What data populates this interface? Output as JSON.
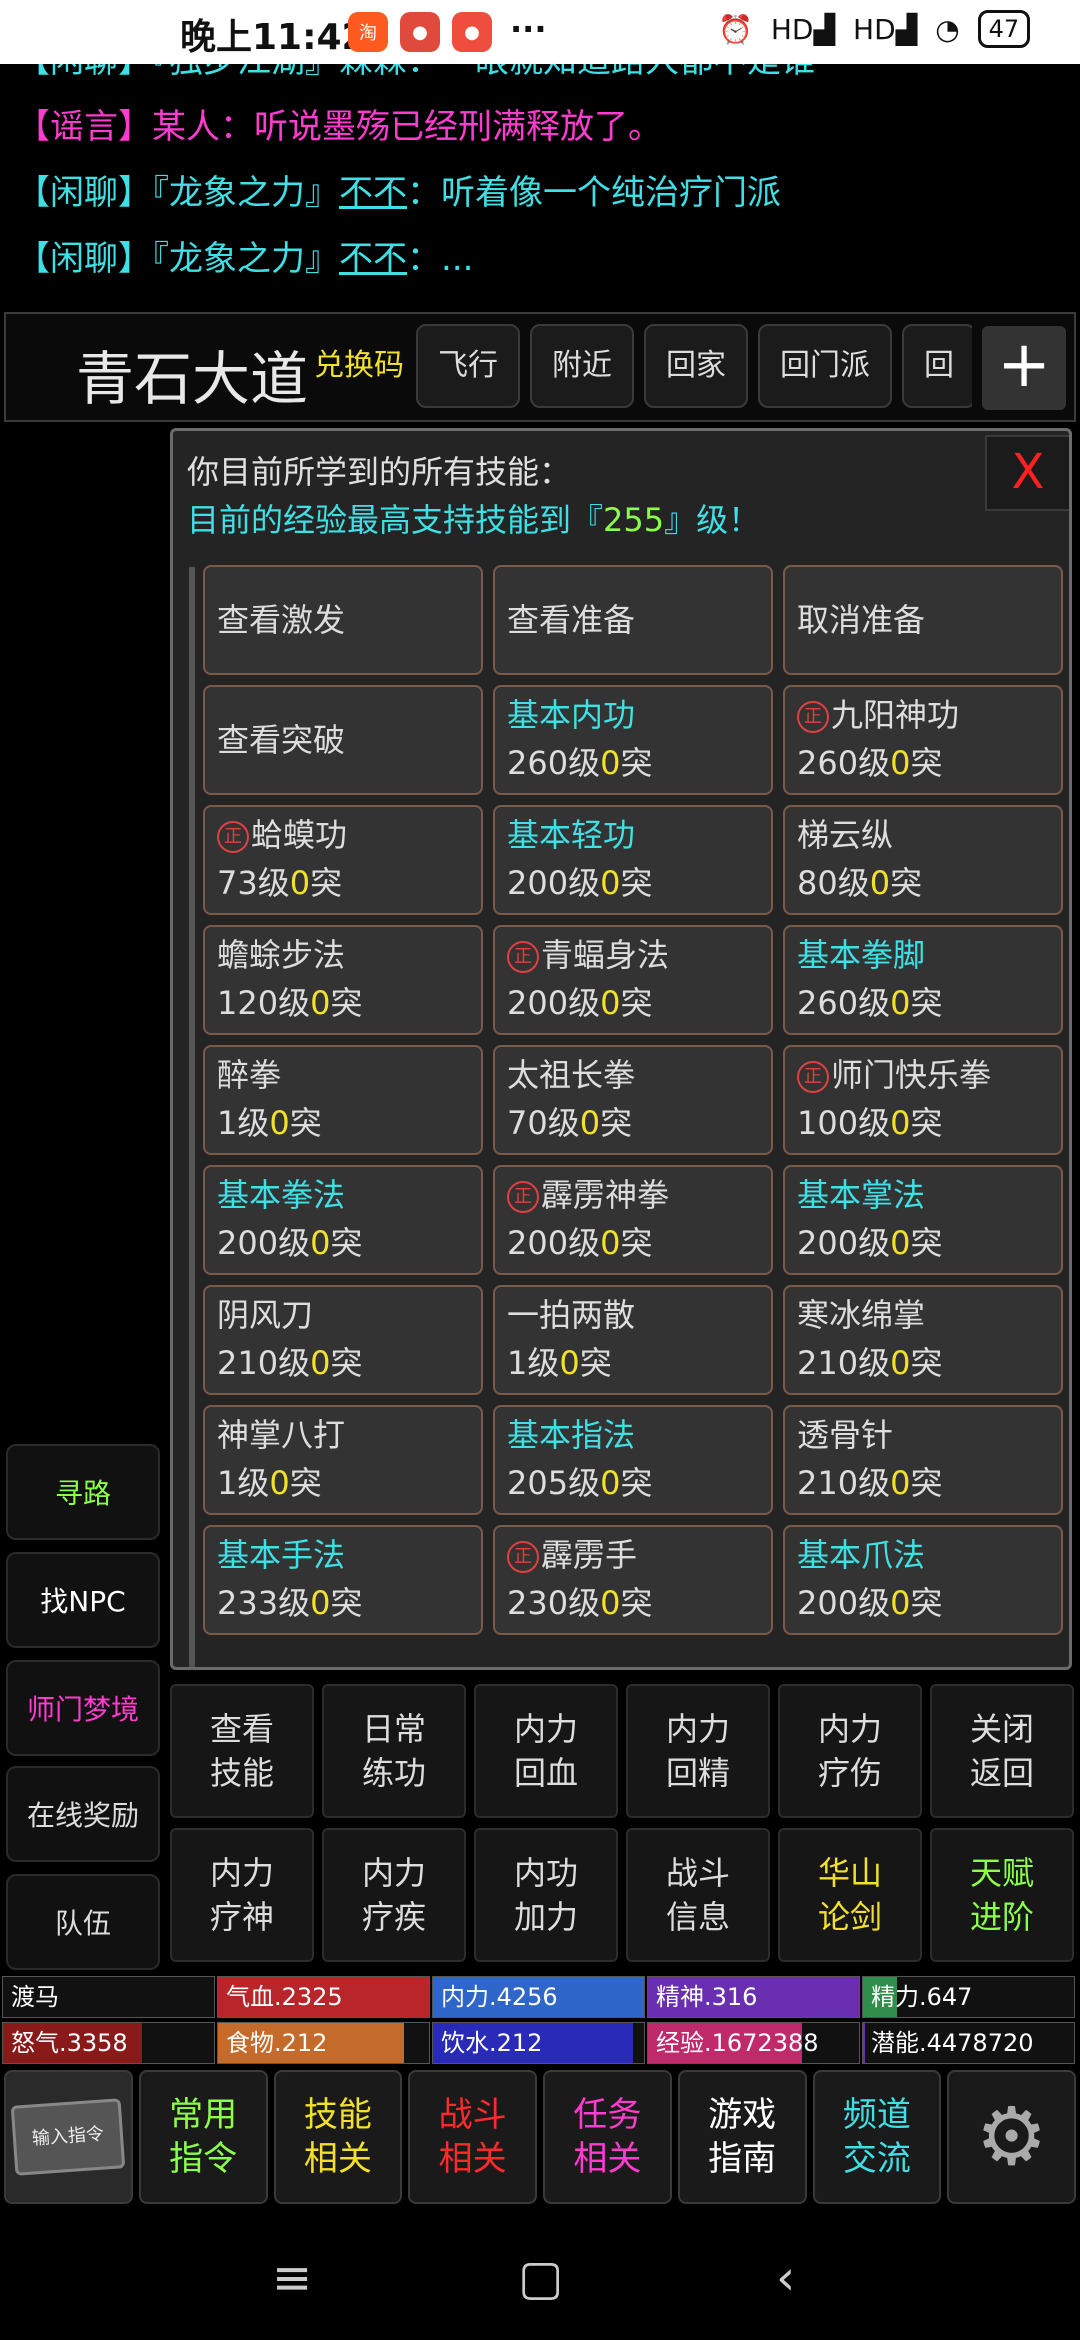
{
  "status_bar": {
    "time": "晚上11:42",
    "apps": [
      {
        "icon": "taobao-app-icon",
        "text": "淘",
        "color": "#ff5a1f"
      },
      {
        "icon": "game-app-icon",
        "text": "●",
        "color": "#e04a3c"
      },
      {
        "icon": "music-app-icon",
        "text": "●",
        "color": "#ef4e3e"
      }
    ],
    "more": "···",
    "signal1": "HD",
    "signal2": "HD",
    "battery": "47"
  },
  "chat": {
    "partial": {
      "tag": "【闲聊】",
      "text": "『独步江湖』霖霖：一眼就知道路人都不是谁"
    },
    "lines": [
      {
        "tag": "【谣言】",
        "kind": "rumor",
        "text": "某人：听说墨殇已经刑满释放了。"
      },
      {
        "tag": "【闲聊】",
        "kind": "chat",
        "text1": "『龙象之力』",
        "user": "不不",
        "text2": "：听着像一个纯治疗门派"
      },
      {
        "tag": "【闲聊】",
        "kind": "chat",
        "text1": "『龙象之力』",
        "user": "不不",
        "text2": "：..."
      }
    ]
  },
  "location": {
    "name": "青石大道",
    "quick": [
      "兑换码",
      "飞行",
      "附近",
      "回家",
      "回门派",
      "回"
    ],
    "plus": "+"
  },
  "side_buttons": [
    {
      "label": "寻路",
      "color": "#8cff4a"
    },
    {
      "label": "找NPC",
      "color": "#ffffff"
    },
    {
      "label": "师门梦境",
      "color": "#ff3bd0"
    },
    {
      "label": "在线奖励",
      "color": "#dddddd"
    },
    {
      "label": "队伍",
      "color": "#dddddd"
    }
  ],
  "panel": {
    "line1": "你目前所学到的所有技能：",
    "line2_pre": "目前的经验最高支持技能到『",
    "line2_lvl": "255",
    "line2_post": "』级！",
    "close": "X",
    "zheng_glyph": "正",
    "top_buttons": [
      "查看激发",
      "查看准备",
      "取消准备",
      "查看突破"
    ],
    "skills": [
      {
        "name": "基本内功",
        "basic": true,
        "zheng": false,
        "level": "260级",
        "zero": "0",
        "suffix": "突"
      },
      {
        "name": "九阳神功",
        "basic": false,
        "zheng": true,
        "level": "260级",
        "zero": "0",
        "suffix": "突"
      },
      {
        "name": "蛤蟆功",
        "basic": false,
        "zheng": true,
        "level": "73级",
        "zero": "0",
        "suffix": "突"
      },
      {
        "name": "基本轻功",
        "basic": true,
        "zheng": false,
        "level": "200级",
        "zero": "0",
        "suffix": "突"
      },
      {
        "name": "梯云纵",
        "basic": false,
        "zheng": false,
        "level": "80级",
        "zero": "0",
        "suffix": "突"
      },
      {
        "name": "蟾蜍步法",
        "basic": false,
        "zheng": false,
        "level": "120级",
        "zero": "0",
        "suffix": "突"
      },
      {
        "name": "青蝠身法",
        "basic": false,
        "zheng": true,
        "level": "200级",
        "zero": "0",
        "suffix": "突"
      },
      {
        "name": "基本拳脚",
        "basic": true,
        "zheng": false,
        "level": "260级",
        "zero": "0",
        "suffix": "突"
      },
      {
        "name": "醉拳",
        "basic": false,
        "zheng": false,
        "level": "1级",
        "zero": "0",
        "suffix": "突"
      },
      {
        "name": "太祖长拳",
        "basic": false,
        "zheng": false,
        "level": "70级",
        "zero": "0",
        "suffix": "突"
      },
      {
        "name": "师门快乐拳",
        "basic": false,
        "zheng": true,
        "level": "100级",
        "zero": "0",
        "suffix": "突"
      },
      {
        "name": "基本拳法",
        "basic": true,
        "zheng": false,
        "level": "200级",
        "zero": "0",
        "suffix": "突"
      },
      {
        "name": "霹雳神拳",
        "basic": false,
        "zheng": true,
        "level": "200级",
        "zero": "0",
        "suffix": "突"
      },
      {
        "name": "基本掌法",
        "basic": true,
        "zheng": false,
        "level": "200级",
        "zero": "0",
        "suffix": "突"
      },
      {
        "name": "阴风刀",
        "basic": false,
        "zheng": false,
        "level": "210级",
        "zero": "0",
        "suffix": "突"
      },
      {
        "name": "一拍两散",
        "basic": false,
        "zheng": false,
        "level": "1级",
        "zero": "0",
        "suffix": "突"
      },
      {
        "name": "寒冰绵掌",
        "basic": false,
        "zheng": false,
        "level": "210级",
        "zero": "0",
        "suffix": "突"
      },
      {
        "name": "神掌八打",
        "basic": false,
        "zheng": false,
        "level": "1级",
        "zero": "0",
        "suffix": "突"
      },
      {
        "name": "基本指法",
        "basic": true,
        "zheng": false,
        "level": "205级",
        "zero": "0",
        "suffix": "突"
      },
      {
        "name": "透骨针",
        "basic": false,
        "zheng": false,
        "level": "210级",
        "zero": "0",
        "suffix": "突"
      },
      {
        "name": "基本手法",
        "basic": true,
        "zheng": false,
        "level": "233级",
        "zero": "0",
        "suffix": "突"
      },
      {
        "name": "霹雳手",
        "basic": false,
        "zheng": true,
        "level": "230级",
        "zero": "0",
        "suffix": "突"
      },
      {
        "name": "基本爪法",
        "basic": true,
        "zheng": false,
        "level": "200级",
        "zero": "0",
        "suffix": "突"
      }
    ]
  },
  "actions": [
    {
      "label": "查看\n技能",
      "color": "default"
    },
    {
      "label": "日常\n练功",
      "color": "default"
    },
    {
      "label": "内力\n回血",
      "color": "default"
    },
    {
      "label": "内力\n回精",
      "color": "default"
    },
    {
      "label": "内力\n疗伤",
      "color": "default"
    },
    {
      "label": "关闭\n返回",
      "color": "default"
    },
    {
      "label": "内力\n疗神",
      "color": "default"
    },
    {
      "label": "内力\n疗疾",
      "color": "default"
    },
    {
      "label": "内功\n加力",
      "color": "default"
    },
    {
      "label": "战斗\n信息",
      "color": "default"
    },
    {
      "label": "华山\n论剑",
      "color": "yellow"
    },
    {
      "label": "天赋\n进阶",
      "color": "green"
    }
  ],
  "stats": {
    "row1": [
      {
        "label": "渡马",
        "fill": 0,
        "color": "#111111"
      },
      {
        "label": "气血.2325",
        "fill": 1,
        "color": "#b8262a"
      },
      {
        "label": "内力.4256",
        "fill": 1,
        "color": "#2f66c9"
      },
      {
        "label": "精神.316",
        "fill": 1,
        "color": "#6a2fb0"
      },
      {
        "label": "精力.647",
        "fill": 0.16,
        "color": "#2f8f4a"
      }
    ],
    "row2": [
      {
        "label": "怒气.3358",
        "fill": 0.66,
        "color": "#8a1a1a"
      },
      {
        "label": "食物.212",
        "fill": 0.88,
        "color": "#c46a2a"
      },
      {
        "label": "饮水.212",
        "fill": 0.95,
        "color": "#2a2ab8"
      },
      {
        "label": "经验.1672388",
        "fill": 0.73,
        "color": "#c02a6a"
      },
      {
        "label": "潜能.4478720",
        "fill": 0.01,
        "color": "#6a2fb0"
      }
    ]
  },
  "tabs": [
    {
      "label": "输入指令",
      "kind": "input"
    },
    {
      "label": "常用\n指令",
      "color": "#8cff4a"
    },
    {
      "label": "技能\n相关",
      "color": "#f2e02a"
    },
    {
      "label": "战斗\n相关",
      "color": "#ff2a2a"
    },
    {
      "label": "任务\n相关",
      "color": "#ff3bd0"
    },
    {
      "label": "游戏\n指南",
      "color": "#ffffff"
    },
    {
      "label": "频道\n交流",
      "color": "#3ee0e6"
    },
    {
      "label": "系统",
      "kind": "gear"
    }
  ],
  "navbar": {
    "menu": "≡",
    "home": "▢",
    "back": "‹"
  }
}
